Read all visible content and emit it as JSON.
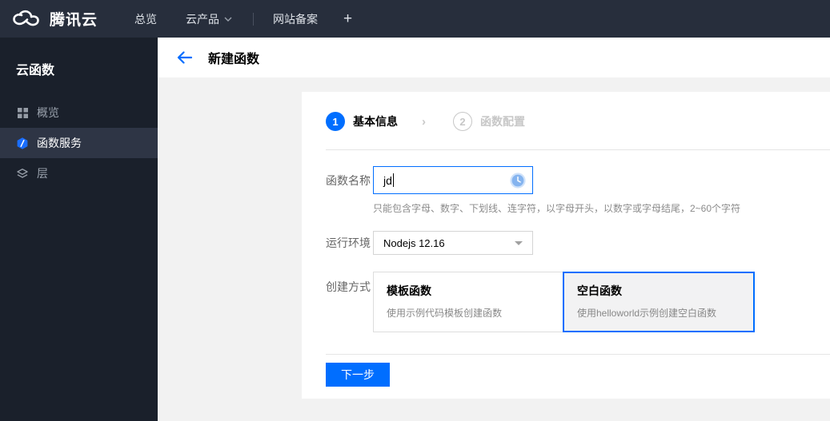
{
  "colors": {
    "accent": "#006eff",
    "topnav_bg": "#272e3c",
    "sidebar_bg": "#1a202b",
    "sidebar_active_bg": "#2e3545",
    "content_bg": "#f2f2f2",
    "selected_card_bg": "#f2f2f3"
  },
  "topnav": {
    "brand": "腾讯云",
    "overview": "总览",
    "products": "云产品",
    "beian": "网站备案",
    "plus": "+"
  },
  "sidebar": {
    "title": "云函数",
    "items": [
      {
        "label": "概览",
        "icon": "grid-icon",
        "active": false
      },
      {
        "label": "函数服务",
        "icon": "scf-hexagon-icon",
        "active": true
      },
      {
        "label": "层",
        "icon": "layers-icon",
        "active": false
      }
    ]
  },
  "page": {
    "title": "新建函数"
  },
  "steps": [
    {
      "number": "1",
      "label": "基本信息",
      "active": true
    },
    {
      "number": "2",
      "label": "函数配置",
      "active": false
    }
  ],
  "form": {
    "name": {
      "label": "函数名称",
      "value": "jd",
      "hint": "只能包含字母、数字、下划线、连字符，以字母开头，以数字或字母结尾，2~60个字符"
    },
    "runtime": {
      "label": "运行环境",
      "value": "Nodejs 12.16"
    },
    "method": {
      "label": "创建方式",
      "options": [
        {
          "title": "模板函数",
          "desc": "使用示例代码模板创建函数",
          "selected": false
        },
        {
          "title": "空白函数",
          "desc": "使用helloworld示例创建空白函数",
          "selected": true
        }
      ]
    },
    "next_label": "下一步"
  }
}
